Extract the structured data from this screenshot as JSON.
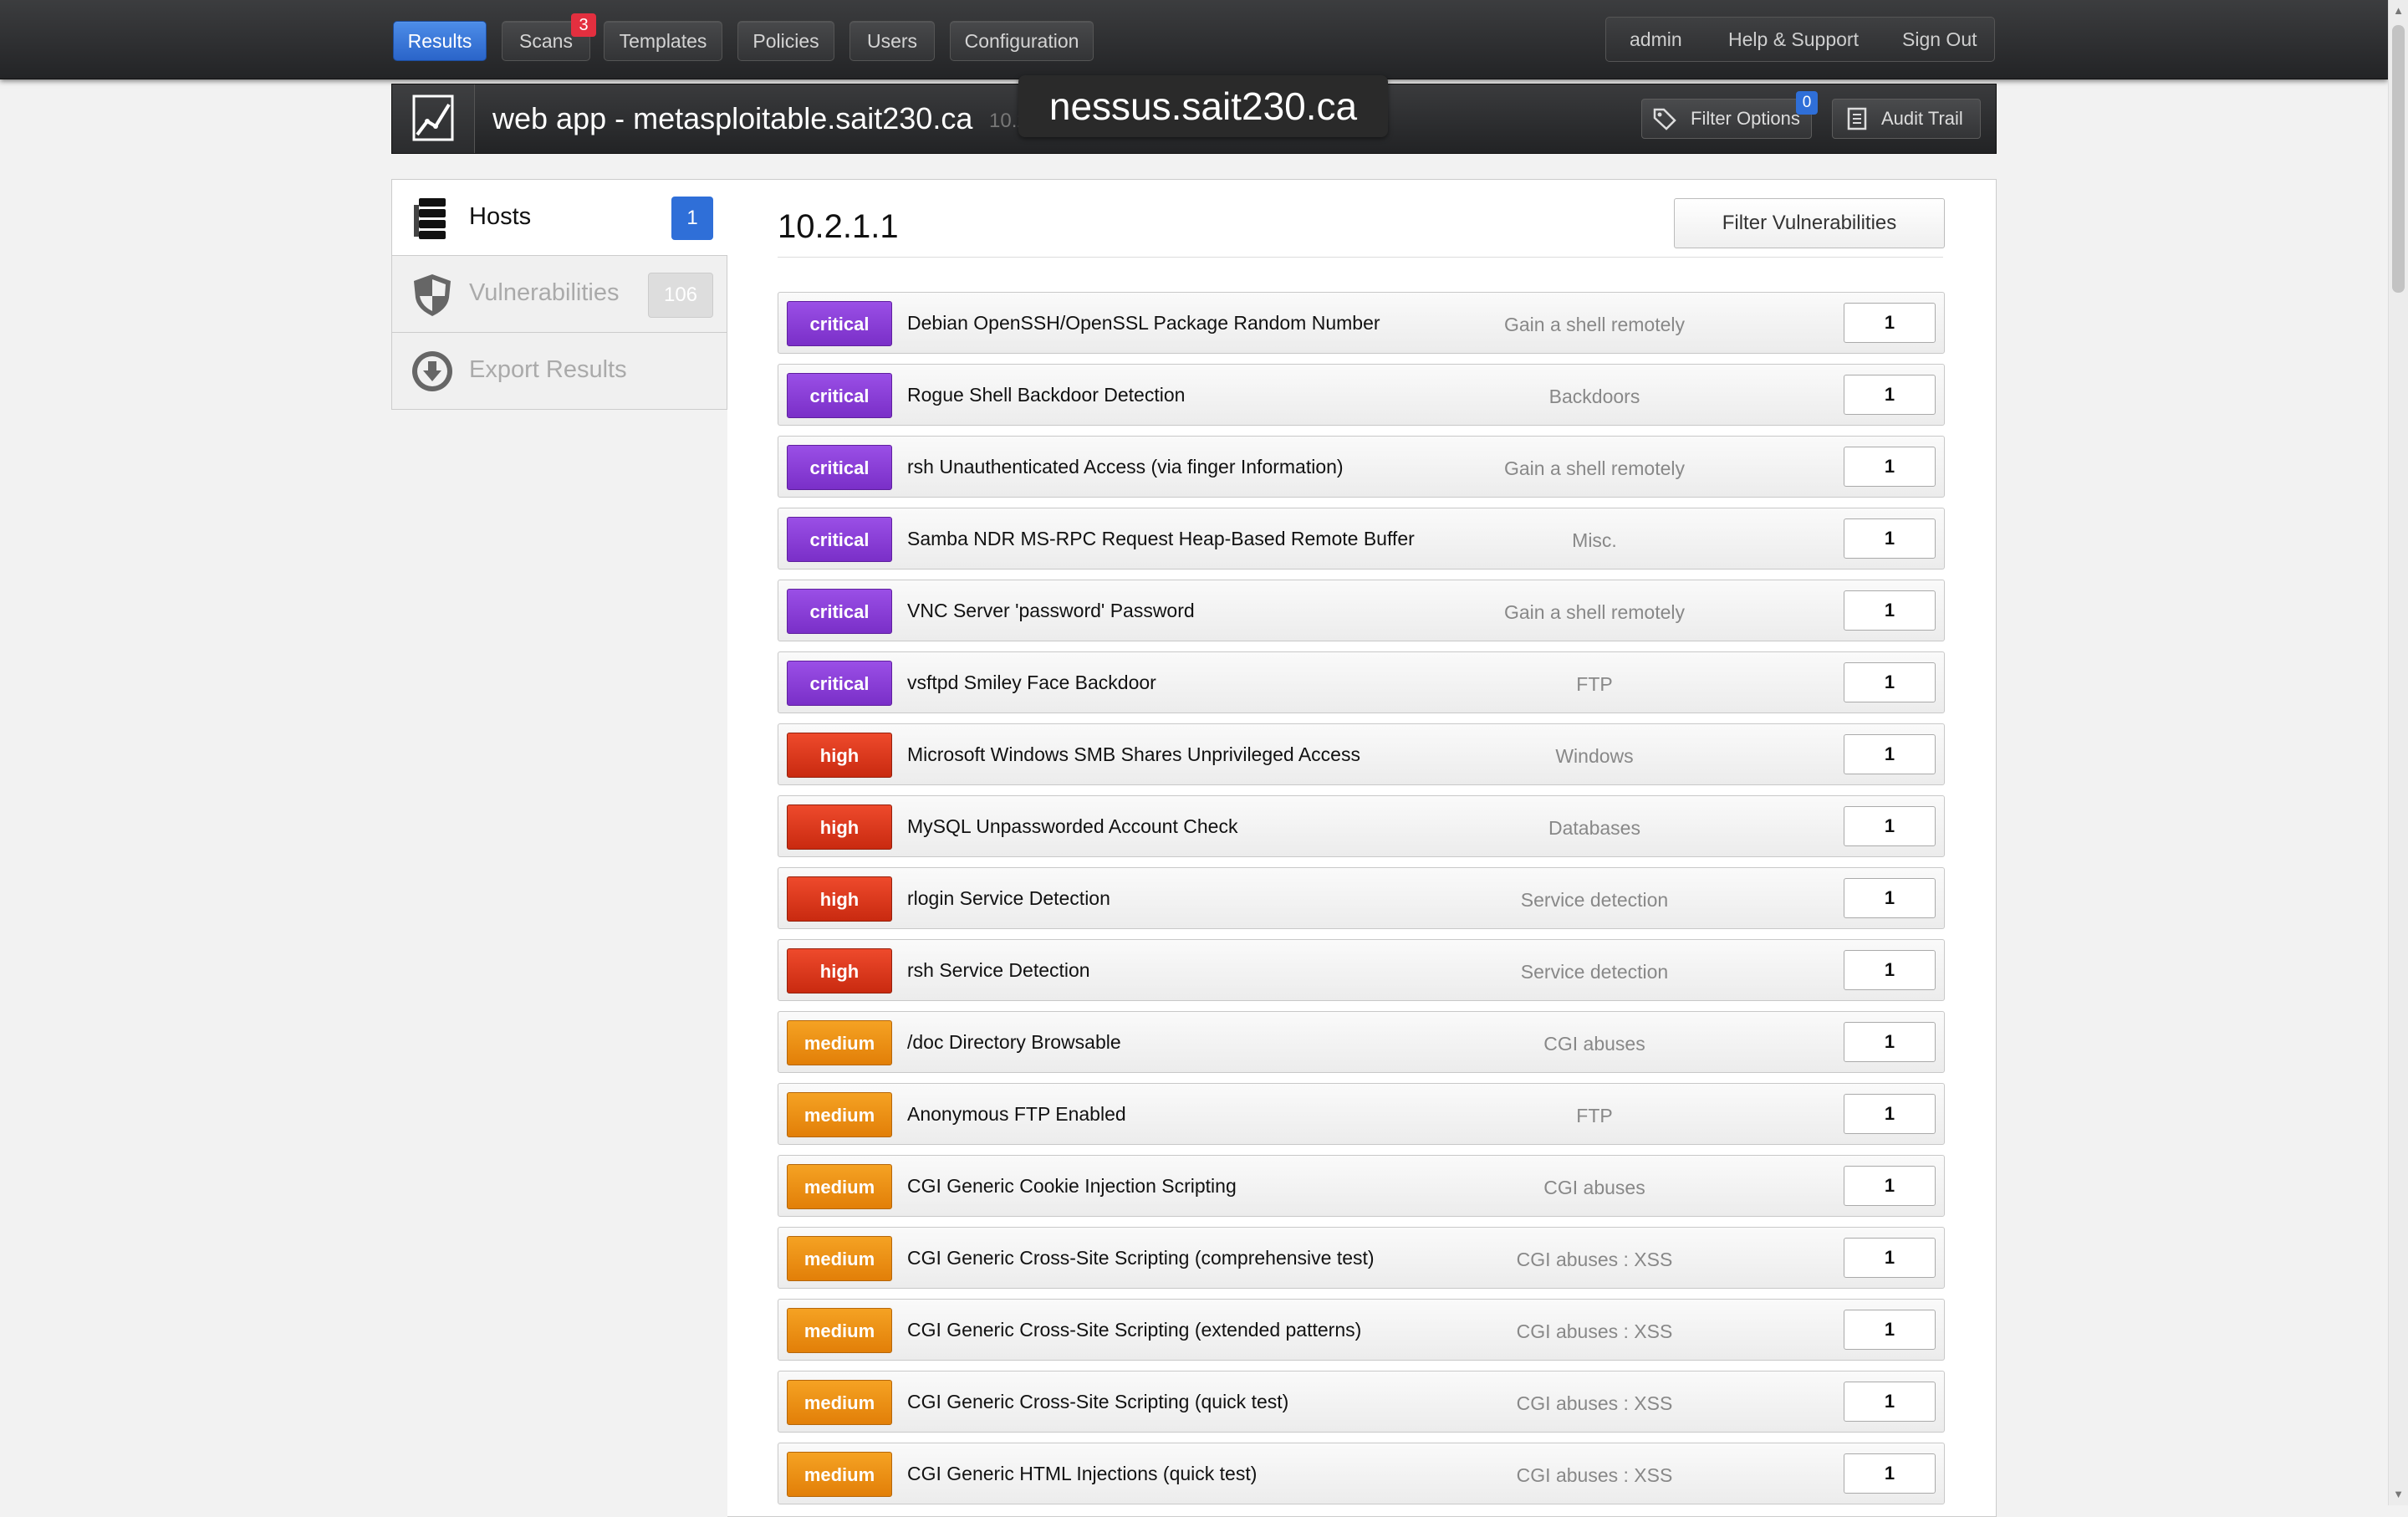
{
  "nav": {
    "items": [
      {
        "label": "Results",
        "active": true
      },
      {
        "label": "Scans",
        "badge": "3"
      },
      {
        "label": "Templates"
      },
      {
        "label": "Policies"
      },
      {
        "label": "Users"
      },
      {
        "label": "Configuration"
      }
    ],
    "user_links": [
      "admin",
      "Help & Support",
      "Sign Out"
    ]
  },
  "header": {
    "icon": "line-chart-icon",
    "title": "web app - metasploitable.sait230.ca",
    "ip": "10.2.1.1",
    "filter_options_label": "Filter Options",
    "filter_options_badge": "0",
    "audit_trail_label": "Audit Trail"
  },
  "tooltip": "nessus.sait230.ca",
  "sidebar": {
    "items": [
      {
        "label": "Hosts",
        "count": "1",
        "icon": "server-stack-icon"
      },
      {
        "label": "Vulnerabilities",
        "count": "106",
        "icon": "shield-icon"
      },
      {
        "label": "Export Results",
        "icon": "download-icon"
      }
    ]
  },
  "main": {
    "host_title": "10.2.1.1",
    "filter_button": "Filter Vulnerabilities",
    "vulns": [
      {
        "severity": "critical",
        "name": "Debian OpenSSH/OpenSSL Package Random Number",
        "family": "Gain a shell remotely",
        "count": "1"
      },
      {
        "severity": "critical",
        "name": "Rogue Shell Backdoor Detection",
        "family": "Backdoors",
        "count": "1"
      },
      {
        "severity": "critical",
        "name": "rsh Unauthenticated Access (via finger Information)",
        "family": "Gain a shell remotely",
        "count": "1"
      },
      {
        "severity": "critical",
        "name": "Samba NDR MS-RPC Request Heap-Based Remote Buffer",
        "family": "Misc.",
        "count": "1"
      },
      {
        "severity": "critical",
        "name": "VNC Server 'password' Password",
        "family": "Gain a shell remotely",
        "count": "1"
      },
      {
        "severity": "critical",
        "name": "vsftpd Smiley Face Backdoor",
        "family": "FTP",
        "count": "1"
      },
      {
        "severity": "high",
        "name": "Microsoft Windows SMB Shares Unprivileged Access",
        "family": "Windows",
        "count": "1"
      },
      {
        "severity": "high",
        "name": "MySQL Unpassworded Account Check",
        "family": "Databases",
        "count": "1"
      },
      {
        "severity": "high",
        "name": "rlogin Service Detection",
        "family": "Service detection",
        "count": "1"
      },
      {
        "severity": "high",
        "name": "rsh Service Detection",
        "family": "Service detection",
        "count": "1"
      },
      {
        "severity": "medium",
        "name": "/doc Directory Browsable",
        "family": "CGI abuses",
        "count": "1"
      },
      {
        "severity": "medium",
        "name": "Anonymous FTP Enabled",
        "family": "FTP",
        "count": "1"
      },
      {
        "severity": "medium",
        "name": "CGI Generic Cookie Injection Scripting",
        "family": "CGI abuses",
        "count": "1"
      },
      {
        "severity": "medium",
        "name": "CGI Generic Cross-Site Scripting (comprehensive test)",
        "family": "CGI abuses : XSS",
        "count": "1"
      },
      {
        "severity": "medium",
        "name": "CGI Generic Cross-Site Scripting (extended patterns)",
        "family": "CGI abuses : XSS",
        "count": "1"
      },
      {
        "severity": "medium",
        "name": "CGI Generic Cross-Site Scripting (quick test)",
        "family": "CGI abuses : XSS",
        "count": "1"
      },
      {
        "severity": "medium",
        "name": "CGI Generic HTML Injections (quick test)",
        "family": "CGI abuses : XSS",
        "count": "1"
      }
    ]
  },
  "colors": {
    "critical": "#8a3fd8",
    "high": "#dd3a1c",
    "medium": "#f08f12",
    "accent": "#2f6fd8"
  }
}
